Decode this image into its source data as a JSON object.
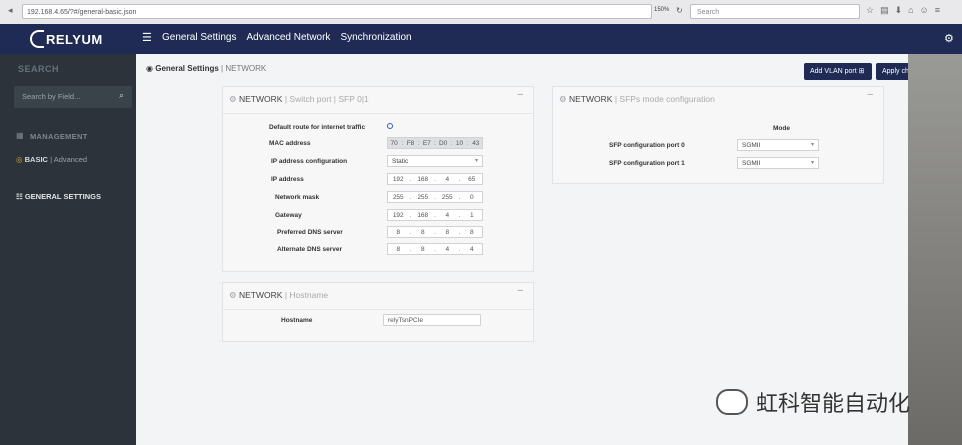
{
  "browser": {
    "url": "192.168.4.65/?#/general-basic.json",
    "zoom": "150%",
    "search_placeholder": "Search"
  },
  "header": {
    "brand": "RELYUM",
    "nav": [
      "General Settings",
      "Advanced Network",
      "Synchronization"
    ]
  },
  "sidebar": {
    "search_title": "SEARCH",
    "search_placeholder": "Search by Field...",
    "management_title": "MANAGEMENT",
    "basic_label": "BASIC",
    "advanced_label": "Advanced",
    "general_settings": "GENERAL SETTINGS"
  },
  "main": {
    "breadcrumb_bold": "General Settings",
    "breadcrumb_sep": "|",
    "breadcrumb_page": "NETWORK",
    "add_vlan_label": "Add VLAN port",
    "apply_label": "Apply changes"
  },
  "panel_switch": {
    "title": "NETWORK",
    "subtitle": "| Switch port | SFP 0|1",
    "default_route_label": "Default route for internet traffic",
    "mac_label": "MAC address",
    "mac": [
      "70",
      "F8",
      "E7",
      "D0",
      "10",
      "43"
    ],
    "ipconf_label": "IP address configuration",
    "ipconf_value": "Static",
    "ip_label": "IP address",
    "ip": [
      "192",
      "168",
      "4",
      "65"
    ],
    "mask_label": "Network mask",
    "mask": [
      "255",
      "255",
      "255",
      "0"
    ],
    "gw_label": "Gateway",
    "gw": [
      "192",
      "168",
      "4",
      "1"
    ],
    "dns1_label": "Preferred DNS server",
    "dns1": [
      "8",
      "8",
      "8",
      "8"
    ],
    "dns2_label": "Alternate DNS server",
    "dns2": [
      "8",
      "8",
      "4",
      "4"
    ]
  },
  "panel_host": {
    "title": "NETWORK",
    "subtitle": "| Hostname",
    "hostname_label": "Hostname",
    "hostname_value": "relyTsnPCIe"
  },
  "panel_sfp": {
    "title": "NETWORK",
    "subtitle": "| SFPs mode configuration",
    "mode_header": "Mode",
    "port0_label": "SFP configuration port 0",
    "port0_value": "SGMII",
    "port1_label": "SFP configuration port 1",
    "port1_value": "SGMII"
  },
  "watermark": "虹科智能自动化",
  "colors": {
    "header_bg": "#1f2b55",
    "sidebar_bg": "#2c333a",
    "accent_orange": "#f0a020"
  }
}
